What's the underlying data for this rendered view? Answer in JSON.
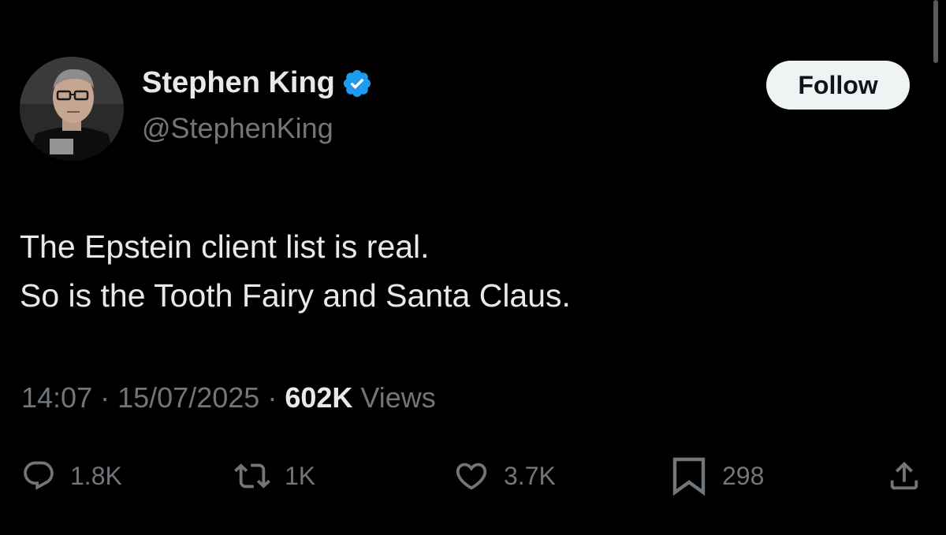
{
  "author": {
    "name": "Stephen King",
    "handle": "@StephenKing",
    "verified": true
  },
  "follow_button": {
    "label": "Follow"
  },
  "tweet": {
    "lines": [
      "The Epstein client list is real.",
      "So is the Tooth Fairy and Santa Claus."
    ]
  },
  "meta": {
    "time": "14:07",
    "separator": "·",
    "date": "15/07/2025",
    "views_count": "602K",
    "views_label": "Views"
  },
  "actions": {
    "replies": "1.8K",
    "reposts": "1K",
    "likes": "3.7K",
    "bookmarks": "298"
  },
  "icons": {
    "reply": "reply-icon",
    "repost": "repost-icon",
    "like": "heart-icon",
    "bookmark": "bookmark-icon",
    "share": "share-icon",
    "verified": "verified-badge-icon"
  },
  "colors": {
    "background": "#000000",
    "primary_text": "#e7e9ea",
    "secondary_text": "#71767b",
    "verified_blue": "#1d9bf0",
    "follow_bg": "#eff3f4"
  }
}
